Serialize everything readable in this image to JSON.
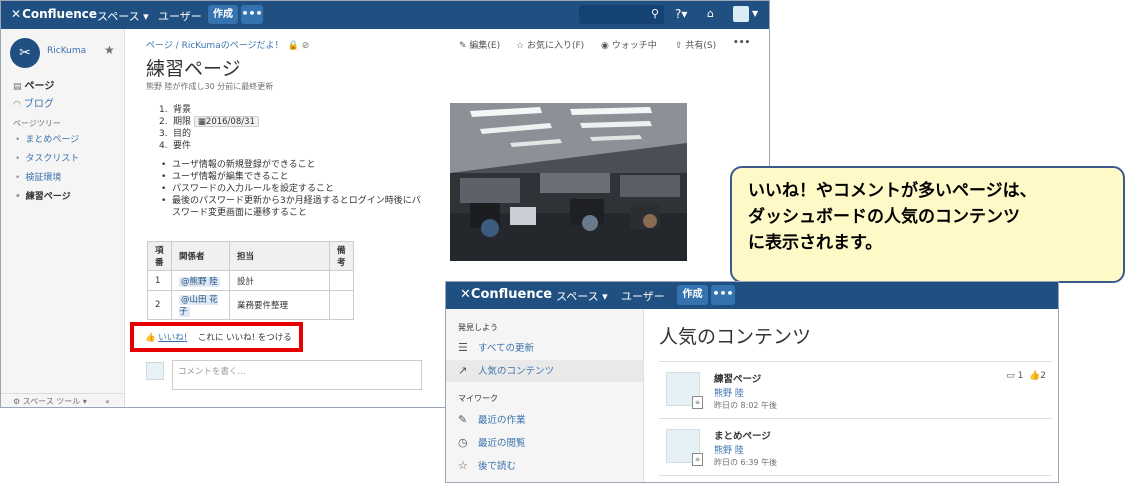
{
  "app": {
    "logo": "Confluence",
    "nav": [
      "スペース ▾",
      "ユーザー"
    ],
    "create_label": "作成",
    "more_label": "•••"
  },
  "sidebar": {
    "space_name": "RicKuma",
    "menu": [
      {
        "icon": "page-icon",
        "label": "ページ"
      },
      {
        "icon": "blog-icon",
        "label": "ブログ"
      }
    ],
    "tree_heading": "ページツリー",
    "tree": [
      {
        "label": "まとめページ",
        "current": false
      },
      {
        "label": "タスクリスト",
        "current": false
      },
      {
        "label": "検証環境",
        "current": false
      },
      {
        "label": "練習ページ",
        "current": true
      }
    ],
    "footer": "スペース ツール ▾"
  },
  "page": {
    "breadcrumb": "ページ / RicKumaのページだよ！",
    "actions": [
      "編集(E)",
      "お気に入り(F)",
      "ウォッチ中",
      "共有(S)",
      "•••"
    ],
    "title": "練習ページ",
    "byline": "熊野 陸が作成し30 分前に最終更新",
    "ordered_list": [
      {
        "num": "1.",
        "text": "背景"
      },
      {
        "num": "2.",
        "text": "期限",
        "date": "2016/08/31"
      },
      {
        "num": "3.",
        "text": "目的"
      },
      {
        "num": "4.",
        "text": "要件"
      }
    ],
    "bullets": [
      "ユーザ情報の新規登録ができること",
      "ユーザ情報が編集できること",
      "パスワードの入力ルールを設定すること",
      "最後のパスワード更新から3か月経過するとログイン時後にパスワード変更画面に遷移すること"
    ],
    "table": {
      "headers": [
        "項番",
        "関係者",
        "担当",
        "備考"
      ],
      "rows": [
        [
          "1",
          "@熊野 陸",
          "設計",
          ""
        ],
        [
          "2",
          "@山田 花子",
          "業務要件整理",
          ""
        ]
      ]
    },
    "like_label": "いいね!",
    "like_hint": "これに いいね! をつける",
    "comment_placeholder": "コメントを書く..."
  },
  "callout": {
    "lines": [
      "いいね！やコメントが多いページは、",
      "ダッシュボードの人気のコンテンツ",
      "に表示されます。"
    ]
  },
  "dashboard": {
    "section_discover": "発見しよう",
    "items_discover": [
      {
        "icon": "list-icon",
        "label": "すべての更新"
      },
      {
        "icon": "trend-icon",
        "label": "人気のコンテンツ",
        "selected": true
      }
    ],
    "section_mywork": "マイワーク",
    "items_mywork": [
      {
        "icon": "edit-icon",
        "label": "最近の作業"
      },
      {
        "icon": "clock-icon",
        "label": "最近の閲覧"
      },
      {
        "icon": "star-icon",
        "label": "後で読む"
      }
    ],
    "title": "人気のコンテンツ",
    "entries": [
      {
        "title": "練習ページ",
        "author": "熊野 陸",
        "date": "昨日の 8:02 午後",
        "comments": "1",
        "likes": "2"
      },
      {
        "title": "まとめページ",
        "author": "熊野 陸",
        "date": "昨日の 6:39 午後"
      }
    ]
  }
}
